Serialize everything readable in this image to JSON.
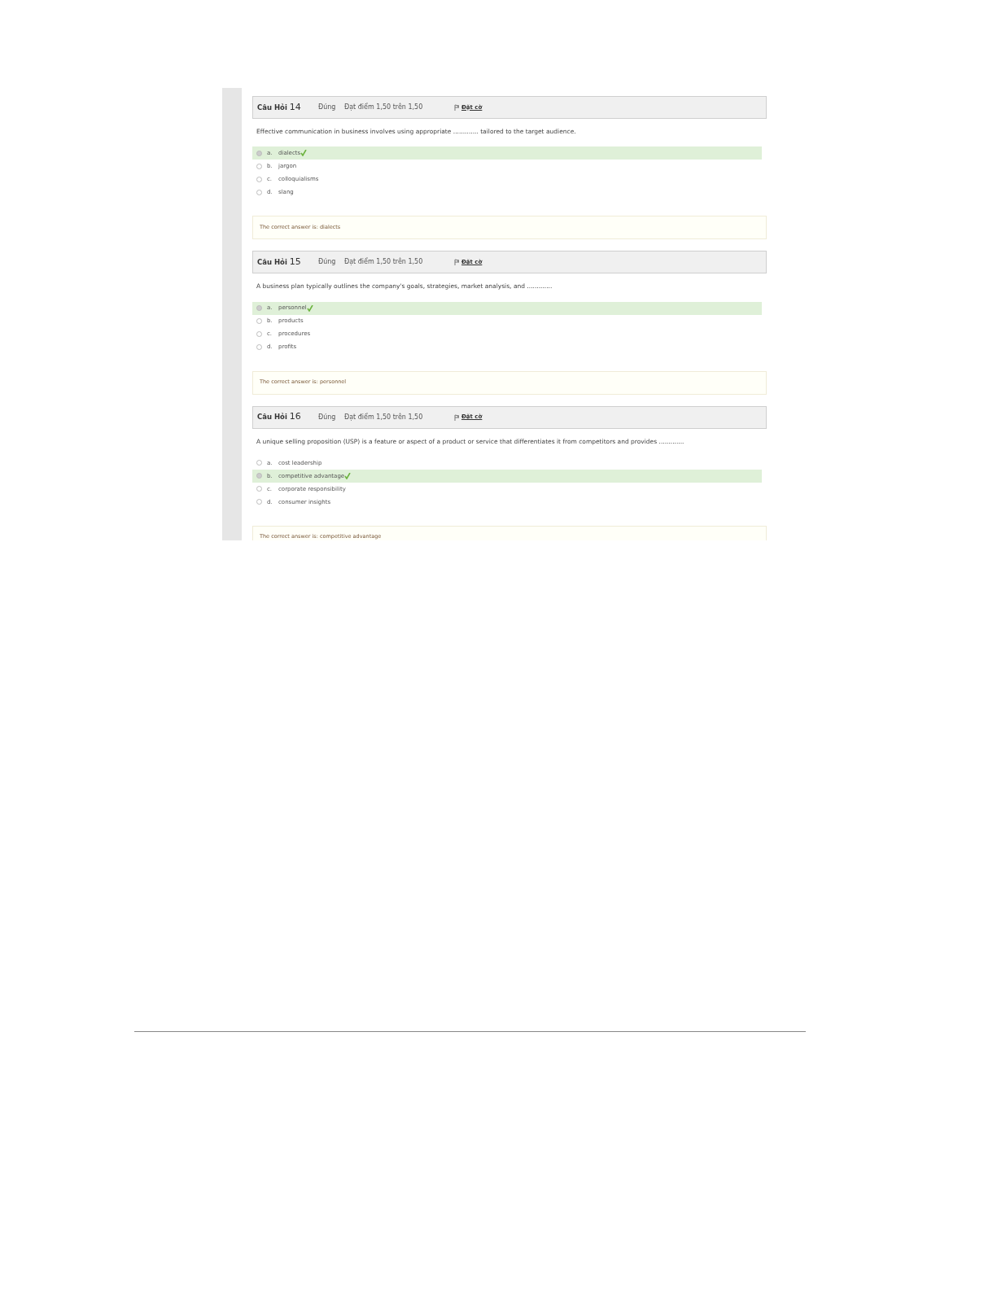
{
  "questions": [
    {
      "label": "Câu Hỏi",
      "number": "14",
      "status": "Đúng",
      "grade": "Đạt điểm 1,50 trên 1,50",
      "flag": "Đặt cờ",
      "text": "Effective communication in business involves using appropriate ............. tailored to the target audience.",
      "options": [
        {
          "letter": "a.",
          "text": "dialects",
          "selected": true,
          "correct": true
        },
        {
          "letter": "b.",
          "text": "jargon",
          "selected": false,
          "correct": false
        },
        {
          "letter": "c.",
          "text": "colloquialisms",
          "selected": false,
          "correct": false
        },
        {
          "letter": "d.",
          "text": "slang",
          "selected": false,
          "correct": false
        }
      ],
      "feedback": "The correct answer is: dialects"
    },
    {
      "label": "Câu Hỏi",
      "number": "15",
      "status": "Đúng",
      "grade": "Đạt điểm 1,50 trên 1,50",
      "flag": "Đặt cờ",
      "text": "A business plan typically outlines the company's goals, strategies, market analysis, and .............",
      "options": [
        {
          "letter": "a.",
          "text": "personnel",
          "selected": true,
          "correct": true
        },
        {
          "letter": "b.",
          "text": "products",
          "selected": false,
          "correct": false
        },
        {
          "letter": "c.",
          "text": "procedures",
          "selected": false,
          "correct": false
        },
        {
          "letter": "d.",
          "text": "profits",
          "selected": false,
          "correct": false
        }
      ],
      "feedback": "The correct answer is: personnel"
    },
    {
      "label": "Câu Hỏi",
      "number": "16",
      "status": "Đúng",
      "grade": "Đạt điểm 1,50 trên 1,50",
      "flag": "Đặt cờ",
      "text": "A unique selling proposition (USP) is a feature or aspect of a product or service that differentiates it from competitors and provides .............",
      "options": [
        {
          "letter": "a.",
          "text": "cost leadership",
          "selected": false,
          "correct": false
        },
        {
          "letter": "b.",
          "text": "competitive advantage",
          "selected": true,
          "correct": true
        },
        {
          "letter": "c.",
          "text": "corporate responsibility",
          "selected": false,
          "correct": false
        },
        {
          "letter": "d.",
          "text": "consumer insights",
          "selected": false,
          "correct": false
        }
      ],
      "feedback": "The correct answer is: competitive advantage"
    }
  ]
}
